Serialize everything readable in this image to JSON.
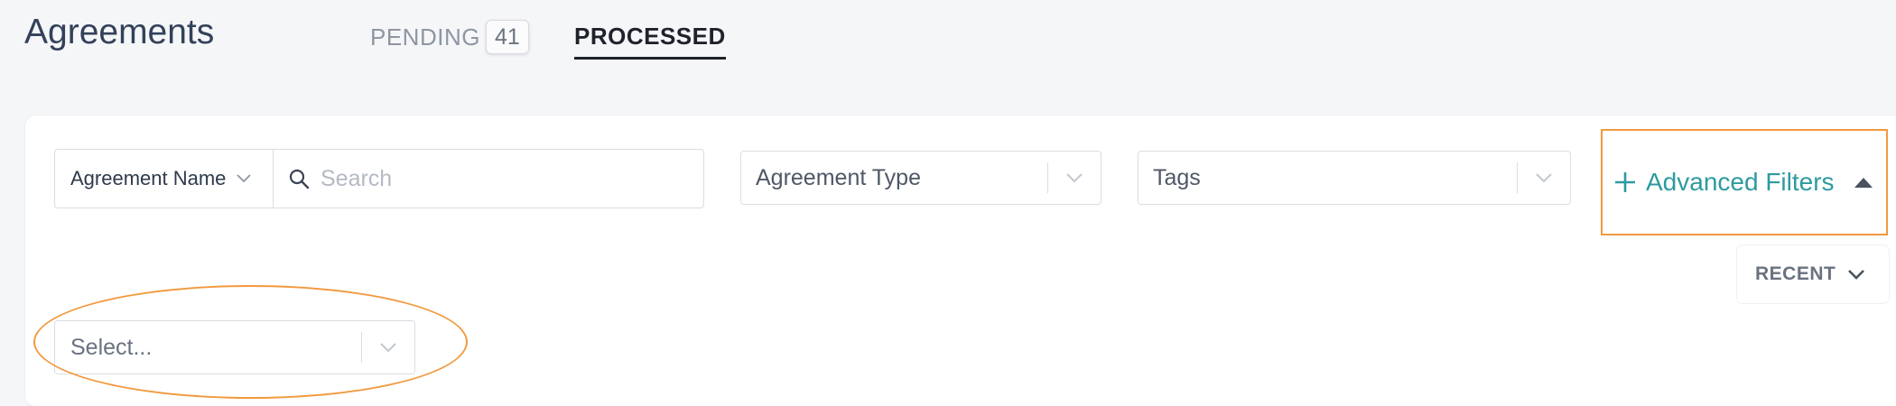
{
  "header": {
    "title": "Agreements",
    "tabs": [
      {
        "label": "PENDING",
        "count": "41",
        "active": false
      },
      {
        "label": "PROCESSED",
        "active": true
      }
    ]
  },
  "filters": {
    "search_field": "Agreement Name",
    "search_placeholder": "Search",
    "agreement_type_placeholder": "Agreement Type",
    "tags_placeholder": "Tags",
    "advanced_filters_label": "Advanced Filters",
    "advanced_select_placeholder": "Select...",
    "sort_label": "RECENT"
  },
  "colors": {
    "accent_teal": "#2e9aa0",
    "highlight_orange": "#f2993f"
  },
  "icons": {
    "search": "search-icon",
    "chevron": "chevron-down-icon",
    "plus": "plus-icon",
    "caret_up": "caret-up-icon"
  }
}
